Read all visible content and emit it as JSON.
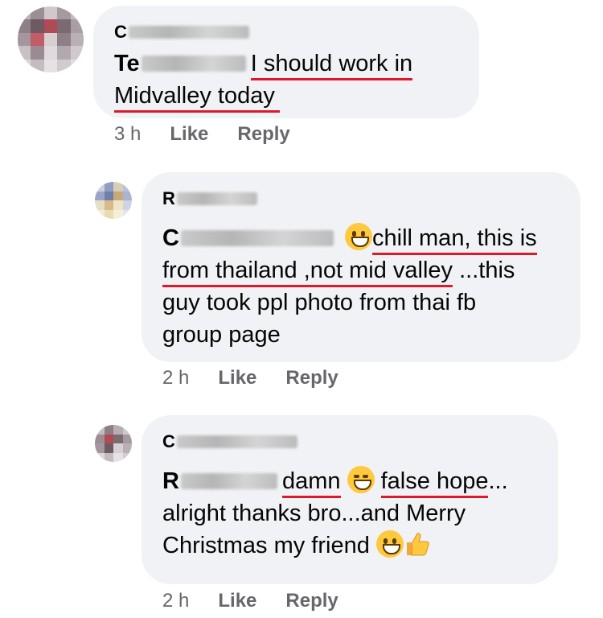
{
  "comments": [
    {
      "author_initial": "C",
      "mention_initial": "Te",
      "text_underlined_1": "I should work in",
      "text_underlined_2": "Midvalley today",
      "time": "3 h",
      "like": "Like",
      "reply": "Reply"
    },
    {
      "author_initial": "R",
      "mention_initial": "C",
      "text_1": "chill man, this is",
      "text_2a": "from thailand ,not mid valley",
      "text_2b": " ...this",
      "text_3": "guy took ppl photo from thai fb",
      "text_4": "group page",
      "time": "2 h",
      "like": "Like",
      "reply": "Reply"
    },
    {
      "author_initial": "C",
      "mention_initial": "R",
      "word_1": "damn",
      "word_2": "false hope",
      "ellipsis": "...",
      "text_2": "alright thanks bro...and Merry",
      "text_3": "Christmas my friend",
      "time": "2 h",
      "like": "Like",
      "reply": "Reply"
    }
  ],
  "icons": {
    "emoji_grin": "grinning-face-icon",
    "emoji_laugh": "laughing-face-icon",
    "emoji_thumb": "thumbs-up-icon"
  },
  "colors": {
    "bubble": "#f0f2f5",
    "meta": "#65676b",
    "underline": "#e0182b"
  }
}
